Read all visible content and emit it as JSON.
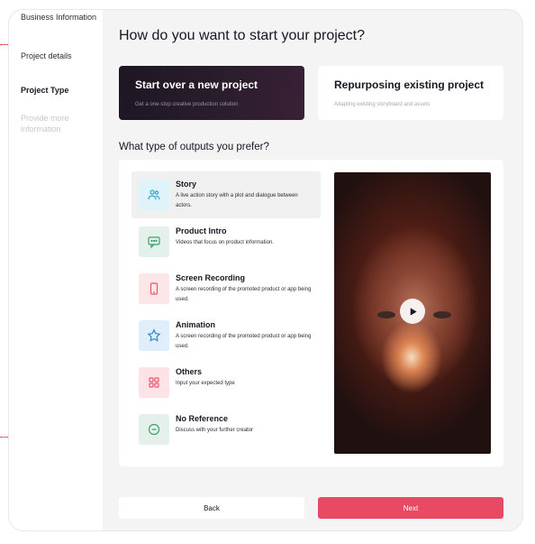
{
  "sidebar": {
    "items": [
      {
        "label": "Business Information",
        "state": "normal"
      },
      {
        "label": "Project details",
        "state": "normal"
      },
      {
        "label": "Project Type",
        "state": "active"
      },
      {
        "label": "Provide more information",
        "state": "disabled"
      }
    ]
  },
  "main": {
    "title": "How do you want to start your project?",
    "modes": [
      {
        "title": "Start over a new project",
        "subtitle": "Get a one-stop creative production solution",
        "selected": true
      },
      {
        "title": "Repurposing existing project",
        "subtitle": "Adapting existing storyboard and assets",
        "selected": false
      }
    ],
    "outputs_title": "What type of outputs you prefer?",
    "options": [
      {
        "title": "Story",
        "desc": "A live action story with a plot and dialogue between actors.",
        "icon": "people-icon",
        "selected": true
      },
      {
        "title": "Product Intro",
        "desc": "Videos that focus on product information.",
        "icon": "chat-icon",
        "selected": false
      },
      {
        "title": "Screen Recording",
        "desc": "A screen recording of the promoted product or app being used.",
        "icon": "phone-icon",
        "selected": false
      },
      {
        "title": "Animation",
        "desc": "A screen recording of the promoted product or app being used.",
        "icon": "star-icon",
        "selected": false
      },
      {
        "title": "Others",
        "desc": "Input your expected type",
        "icon": "grid-icon",
        "selected": false
      },
      {
        "title": "No Reference",
        "desc": "Discuss with your further creator",
        "icon": "minus-circle-icon",
        "selected": false
      }
    ],
    "preview": {
      "icon": "play-icon"
    }
  },
  "footer": {
    "back_label": "Back",
    "next_label": "Next"
  },
  "colors": {
    "accent": "#e84a63",
    "dark_card": "#1d1723",
    "background": "#f4f4f5"
  }
}
